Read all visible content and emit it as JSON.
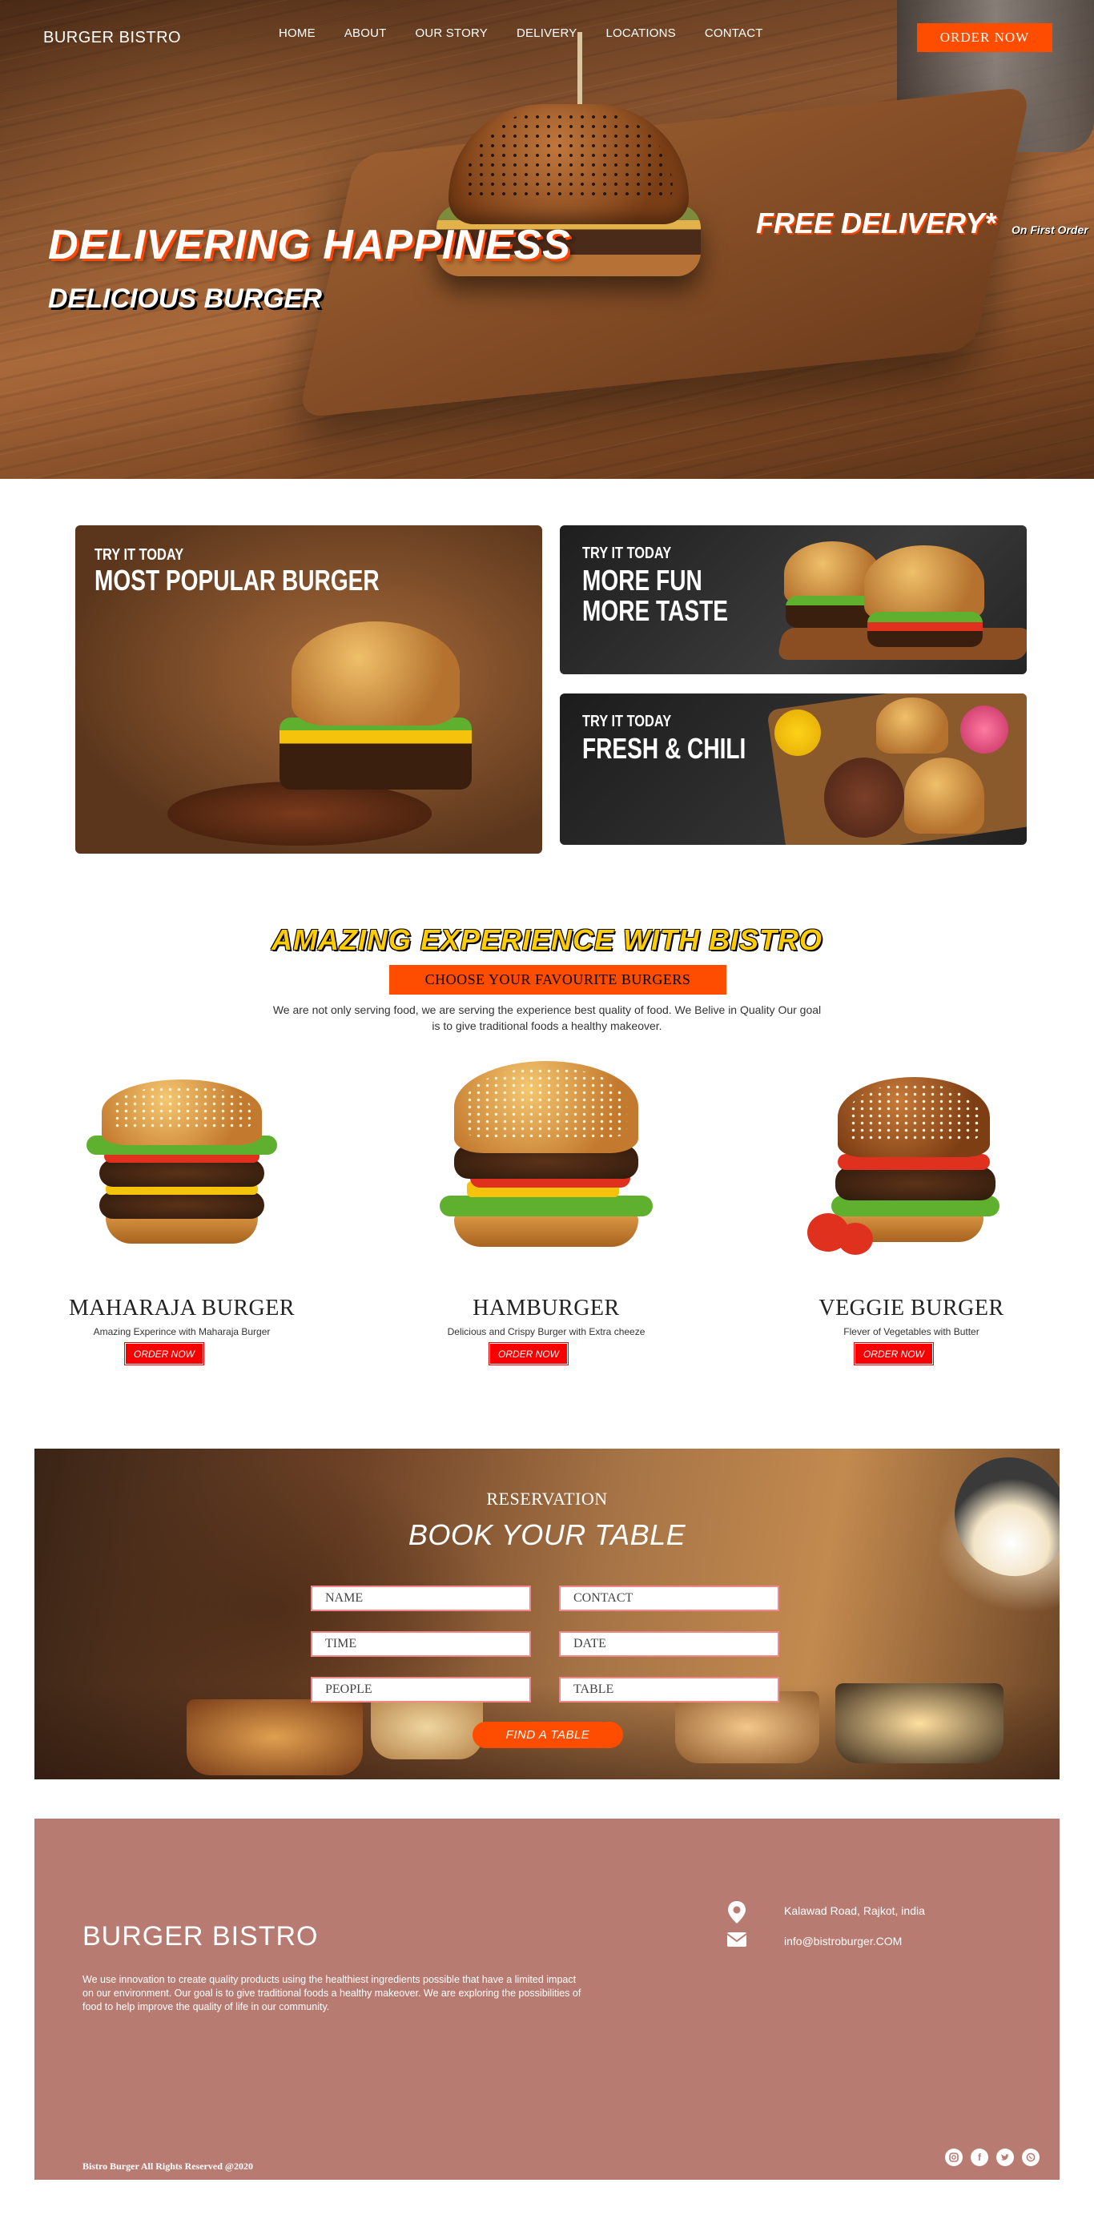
{
  "header": {
    "brand": "BURGER BISTRO",
    "nav": [
      "HOME",
      "ABOUT",
      "OUR STORY",
      "DELIVERY",
      "LOCATIONS",
      "CONTACT"
    ],
    "order_button": "ORDER NOW"
  },
  "hero": {
    "headline": "DELIVERING HAPPINESS",
    "subheadline": "DELICIOUS BURGER",
    "promo": "FREE DELIVERY*",
    "promo_note": "On First Order"
  },
  "promo_cards": [
    {
      "eyebrow": "TRY IT TODAY",
      "line1": "MOST POPULAR BURGER",
      "line2": ""
    },
    {
      "eyebrow": "TRY IT TODAY",
      "line1": "MORE FUN",
      "line2": "MORE TASTE"
    },
    {
      "eyebrow": "TRY IT TODAY",
      "line1": "FRESH & CHILI",
      "line2": ""
    }
  ],
  "experience": {
    "title": "AMAZING EXPERIENCE WITH BISTRO",
    "button": "CHOOSE YOUR FAVOURITE BURGERS",
    "text": "We are not only serving food, we are serving the experience best quality of food. We Belive in Quality Our goal is to give traditional foods a healthy makeover."
  },
  "products": [
    {
      "name": "MAHARAJA BURGER",
      "desc": "Amazing Experince with Maharaja Burger",
      "button": "ORDER NOW"
    },
    {
      "name": "HAMBURGER",
      "desc": "Delicious and Crispy Burger with Extra cheeze",
      "button": "ORDER NOW"
    },
    {
      "name": "VEGGIE BURGER",
      "desc": "Flever of Vegetables with Butter",
      "button": "ORDER NOW"
    }
  ],
  "reservation": {
    "label": "RESERVATION",
    "title": "BOOK YOUR TABLE",
    "fields": {
      "name": "NAME",
      "contact": "CONTACT",
      "time": "TIME",
      "date": "DATE",
      "people": "PEOPLE",
      "table": "TABLE"
    },
    "button": "FIND A TABLE"
  },
  "footer": {
    "brand": "BURGER BISTRO",
    "text": "We use innovation to create quality products using the healthiest ingredients possible that have a limited impact on our environment. Our goal is to give traditional foods a healthy makeover. We are exploring the possibilities of food to help improve the quality of life in our community.",
    "address": "Kalawad Road, Rajkot, india",
    "email": "info@bistroburger.COM",
    "copyright": "Bistro Burger All Rights Reserved @2020",
    "social": [
      "instagram-icon",
      "facebook-icon",
      "twitter-icon",
      "whatsapp-icon"
    ]
  },
  "colors": {
    "accent": "#ff4d00",
    "order_red": "#f70000",
    "footer_bg": "#b87b71",
    "title_yellow": "#ffcc00"
  }
}
